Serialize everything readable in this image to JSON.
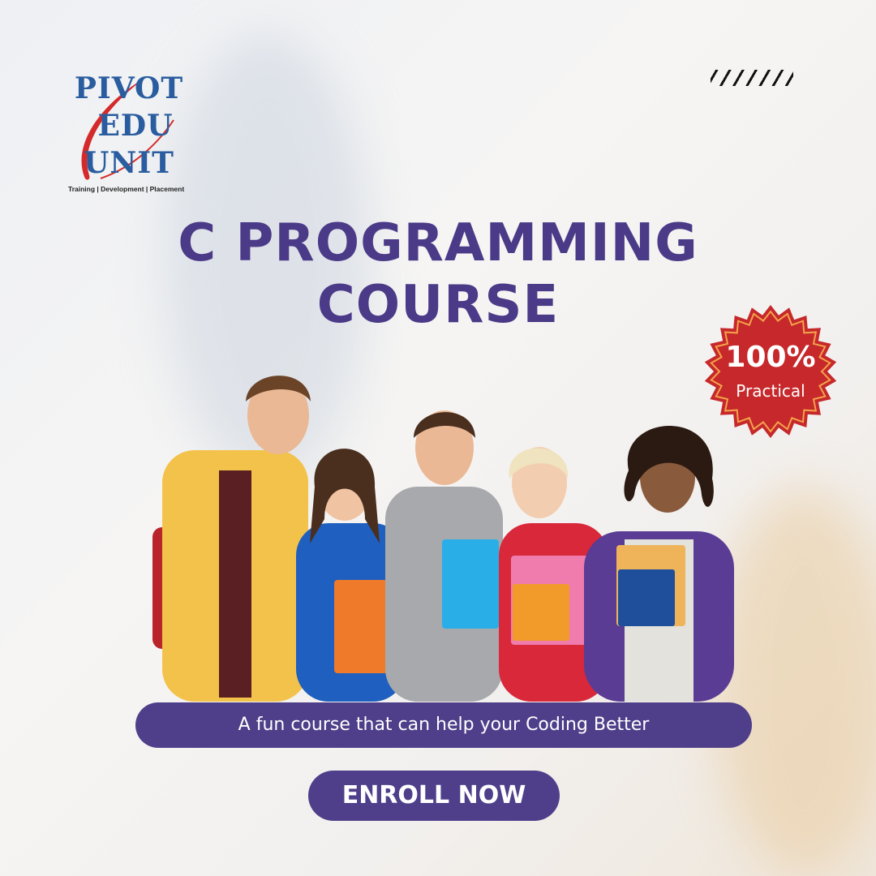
{
  "logo": {
    "lines": [
      "PIVOT",
      "EDU",
      "UNIT"
    ],
    "tagline": "Training | Development | Placement"
  },
  "title": {
    "line1": "C PROGRAMMING",
    "line2": "COURSE"
  },
  "badge": {
    "value": "100%",
    "label": "Practical",
    "color": "#c6282b"
  },
  "subtitle": "A fun course that can help your Coding Better",
  "cta": "ENROLL NOW",
  "colors": {
    "accent": "#4f3f8a",
    "title": "#4b3a87",
    "logo": "#2a5d9f",
    "logo_swoosh": "#d42a2a"
  }
}
